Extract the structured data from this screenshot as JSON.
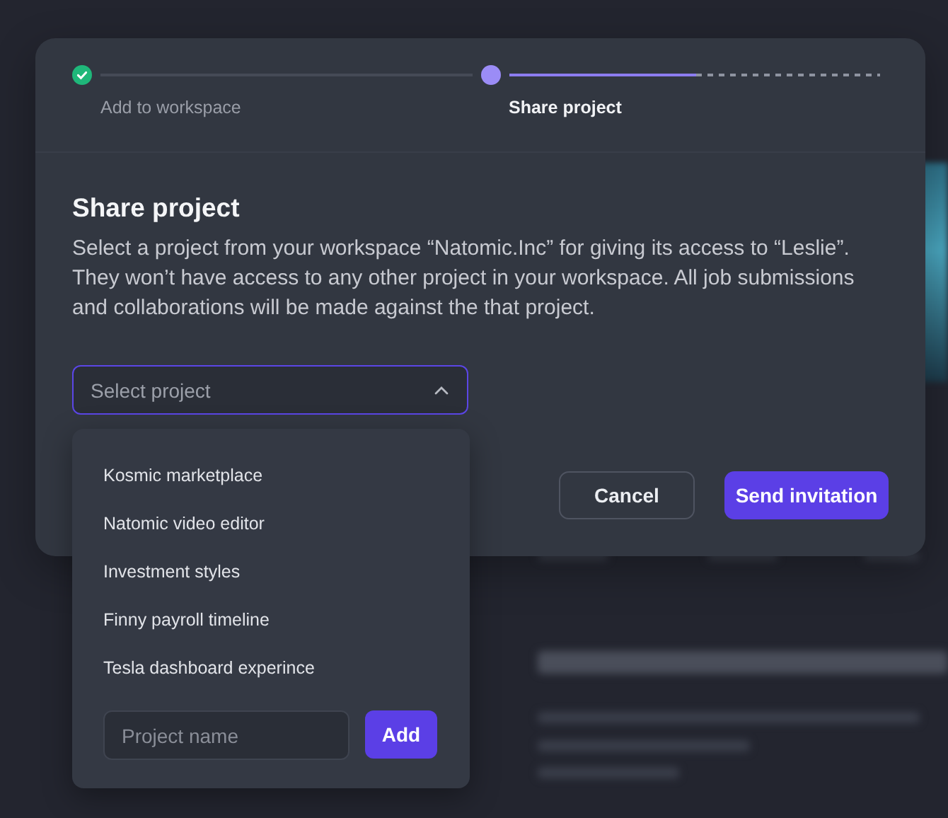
{
  "stepper": {
    "steps": [
      {
        "label": "Add to workspace",
        "done": true,
        "current": false
      },
      {
        "label": "Share project",
        "done": false,
        "current": true,
        "level": 0.5
      }
    ]
  },
  "dialog": {
    "title": "Share project",
    "description": "Select a project from your workspace “Natomic.Inc” for giving its access to “Leslie”. They won’t have access to any other project in your workspace. All job submissions and collaborations will be made against the that project.",
    "select": {
      "placeholder": "Select project",
      "expanded": true
    },
    "options": [
      {
        "label": "Kosmic marketplace"
      },
      {
        "label": "Natomic video editor"
      },
      {
        "label": "Investment styles"
      },
      {
        "label": "Finny payroll timeline"
      },
      {
        "label": "Tesla dashboard experince"
      }
    ],
    "new_project": {
      "placeholder": "Project name",
      "button": "Add"
    },
    "buttons": [
      {
        "label": "Cancel",
        "kind": "secondary"
      },
      {
        "label": "Send invitation",
        "kind": "primary"
      }
    ]
  }
}
